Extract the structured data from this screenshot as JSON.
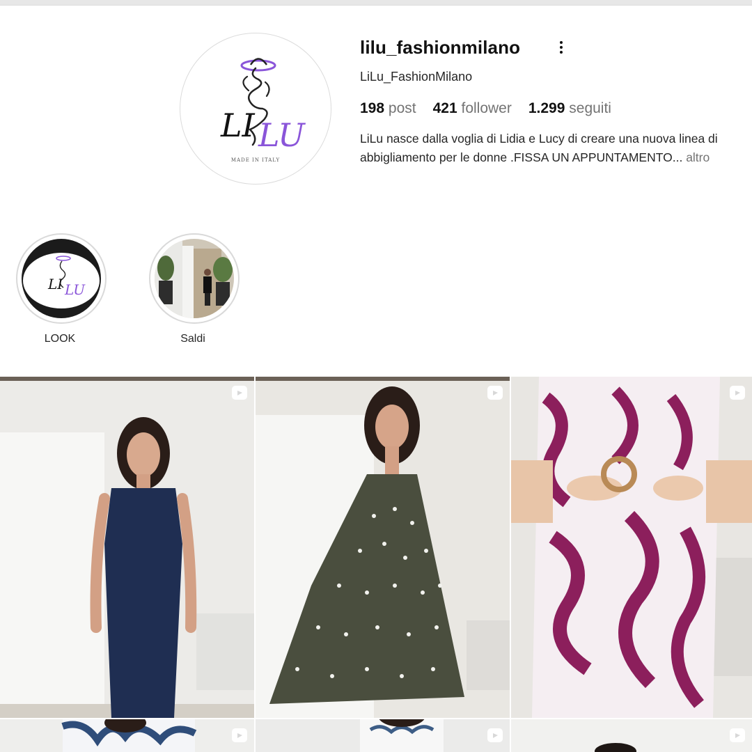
{
  "profile": {
    "username": "lilu_fashionmilano",
    "full_name": "LiLu_FashionMilano",
    "stats": [
      {
        "value": "198",
        "label": "post"
      },
      {
        "value": "421",
        "label": "follower"
      },
      {
        "value": "1.299",
        "label": "seguiti"
      }
    ],
    "bio": "LiLu nasce dalla voglia di Lidia e Lucy di creare una nuova linea di abbigliamento per le donne .FISSA UN APPUNTAMENTO...",
    "bio_more": "altro",
    "logo": {
      "left": "LI",
      "right": "LU",
      "tagline": "MADE IN ITALY"
    }
  },
  "highlights": [
    {
      "label": "LOOK"
    },
    {
      "label": "Saldi"
    }
  ],
  "posts": [
    {
      "type": "reel",
      "desc": "navy sleeveless maxi dress"
    },
    {
      "type": "reel",
      "desc": "olive polka-dot pleated dress"
    },
    {
      "type": "reel",
      "desc": "purple printed dress with belt"
    },
    {
      "type": "reel",
      "desc": "blue and white printed top"
    },
    {
      "type": "reel",
      "desc": "white printed top"
    },
    {
      "type": "reel",
      "desc": "portrait"
    }
  ],
  "colors": {
    "accent_purple": "#8a55d9",
    "text": "#262626",
    "muted": "#737373",
    "border": "#dbdbdb"
  }
}
